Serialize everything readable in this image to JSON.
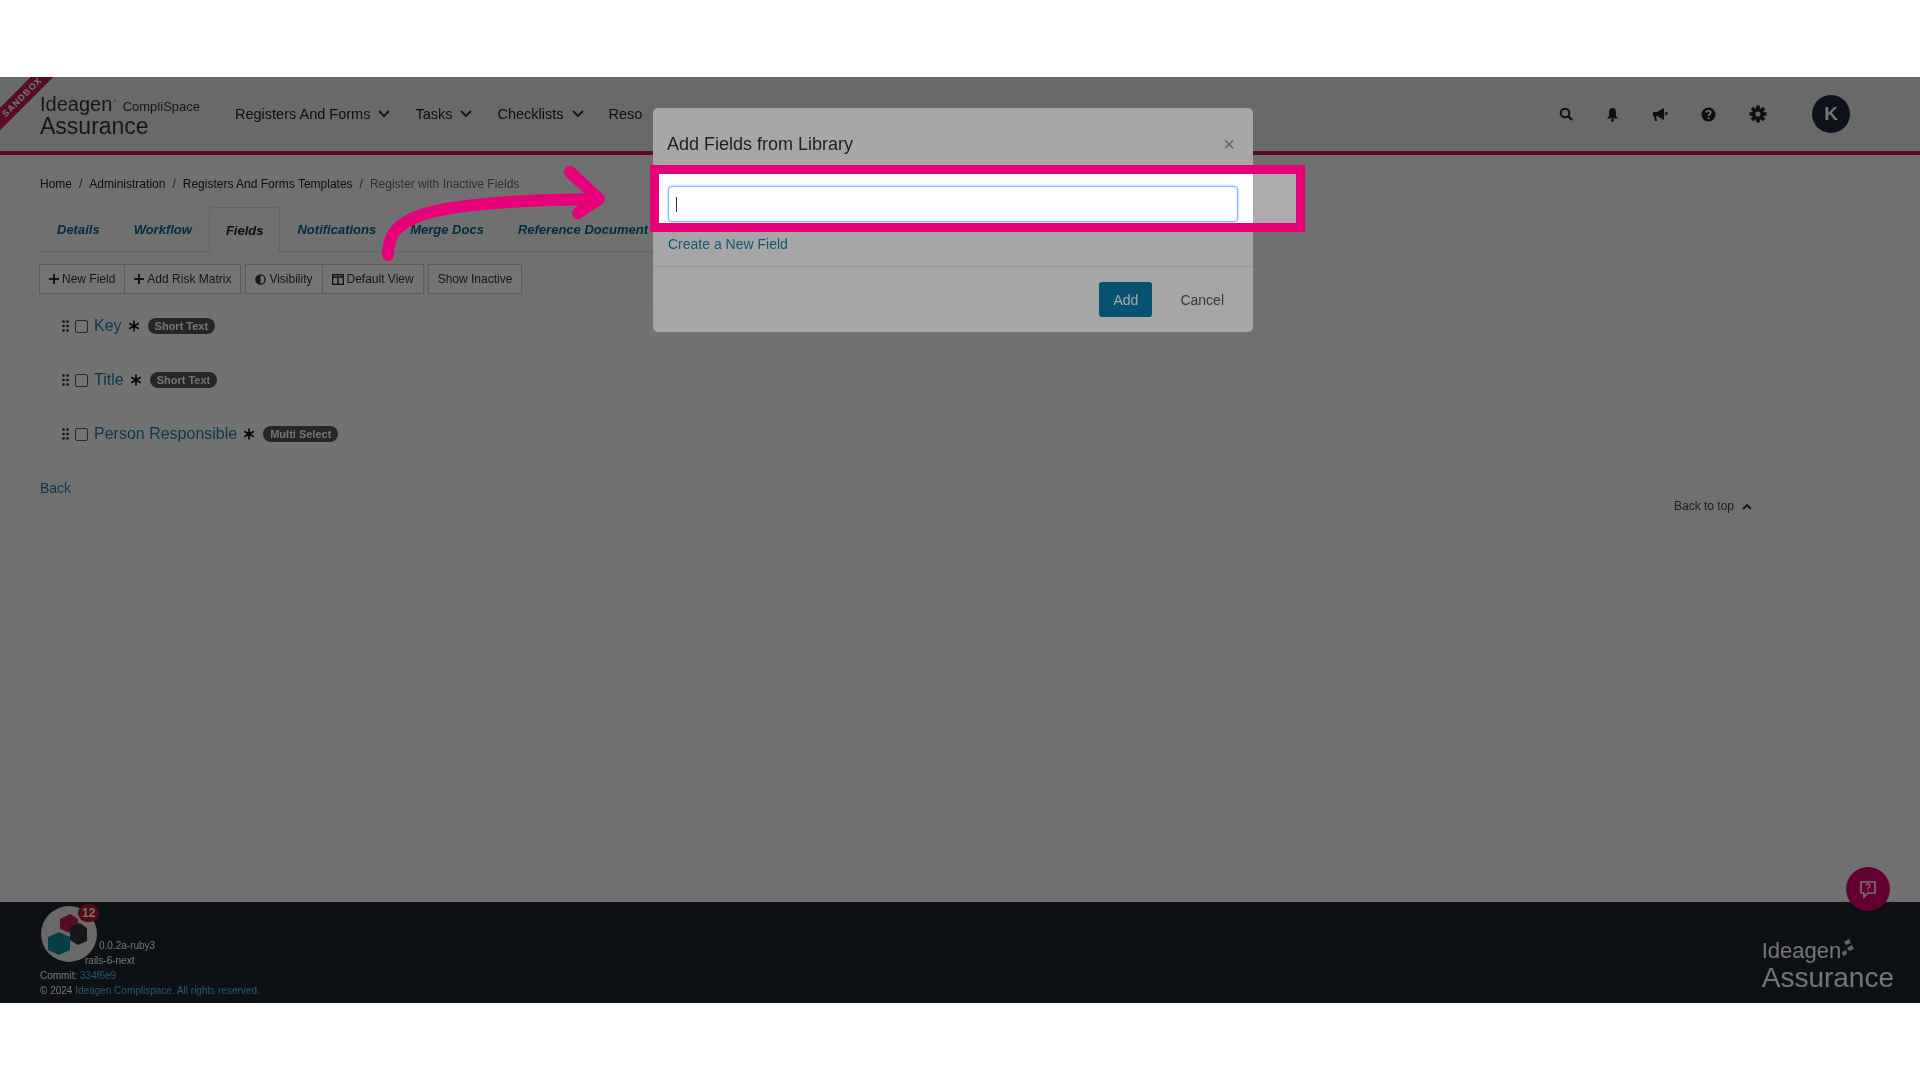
{
  "sandbox_ribbon": "SANDBOX",
  "header": {
    "logo": {
      "brand": "Ideagen",
      "product": "CompliSpace",
      "name": "Assurance"
    },
    "nav": [
      {
        "label": "Registers And Forms",
        "dropdown": true
      },
      {
        "label": "Tasks",
        "dropdown": true
      },
      {
        "label": "Checklists",
        "dropdown": true
      },
      {
        "label": "Reso",
        "dropdown": false
      }
    ],
    "avatar": "K"
  },
  "breadcrumbs": {
    "separator": "/",
    "items": [
      "Home",
      "Administration",
      "Registers And Forms Templates",
      "Register with Inactive Fields"
    ]
  },
  "tabs": [
    {
      "label": "Details",
      "selected": false
    },
    {
      "label": "Workflow",
      "selected": false
    },
    {
      "label": "Fields",
      "selected": true
    },
    {
      "label": "Notifications",
      "selected": false
    },
    {
      "label": "Merge Docs",
      "selected": false
    },
    {
      "label": "Reference Document",
      "selected": false
    }
  ],
  "toolbar": {
    "groups": [
      [
        "New Field",
        "Add Risk Matrix"
      ],
      [
        "Visibility",
        "Default View"
      ],
      [
        "Show Inactive"
      ]
    ]
  },
  "fields": [
    {
      "name": "Key",
      "required": true,
      "type": "Short Text",
      "checked": false
    },
    {
      "name": "Title",
      "required": true,
      "type": "Short Text",
      "checked": false
    },
    {
      "name": "Person Responsible",
      "required": true,
      "type": "Multi Select",
      "checked": false
    }
  ],
  "back_link": "Back",
  "back_to_top": "Back to top",
  "footer": {
    "version": "0.0.2a-ruby3",
    "branch": "rails-6-next",
    "commit_label": "Commit:",
    "commit": "334f6e9",
    "copyright": "© 2024",
    "company_link": "Ideagen Complispace. All rights reserved.",
    "notification_count": "12",
    "logo": {
      "brand": "Ideagen",
      "name": "Assurance"
    }
  },
  "modal": {
    "title": "Add Fields from Library",
    "close": "×",
    "search": {
      "focused": true
    },
    "create_link": "Create a New Field",
    "buttons": [
      {
        "label": "Add",
        "kind": "primary"
      },
      {
        "label": "Cancel",
        "kind": "link"
      }
    ]
  }
}
